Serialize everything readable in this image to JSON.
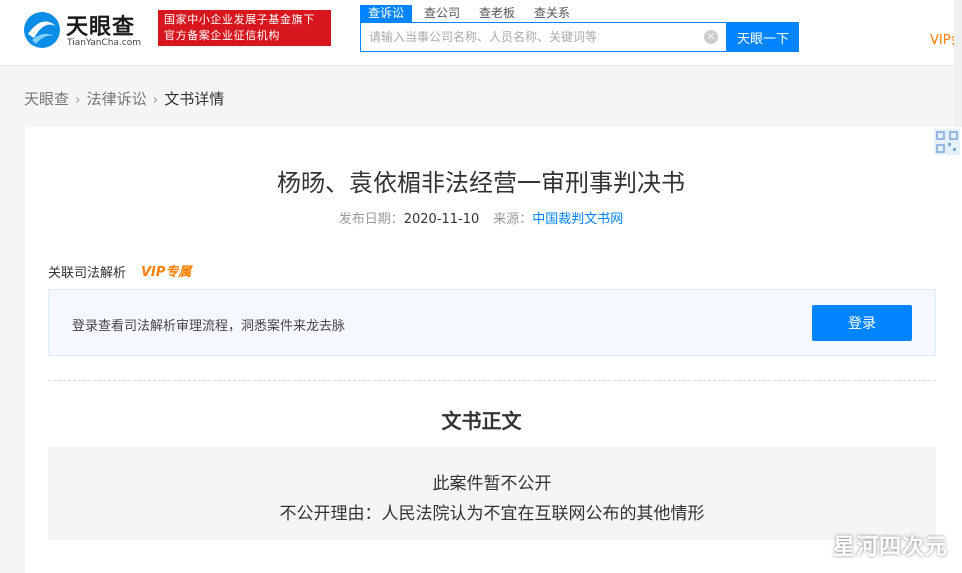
{
  "header": {
    "logo_cn": "天眼查",
    "logo_en": "TianYanCha.com",
    "badge_line1": "国家中小企业发展子基金旗下",
    "badge_line2": "官方备案企业征信机构",
    "tabs": [
      {
        "label": "查诉讼",
        "active": true
      },
      {
        "label": "查公司",
        "active": false
      },
      {
        "label": "查老板",
        "active": false
      },
      {
        "label": "查关系",
        "active": false
      }
    ],
    "search_placeholder": "请输入当事公司名称、人员名称、关键词等",
    "search_button": "天眼一下",
    "vip_link": "VIP会"
  },
  "breadcrumb": {
    "items": [
      "天眼查",
      "法律诉讼",
      "文书详情"
    ]
  },
  "document": {
    "title": "杨旸、袁依楣非法经营一审刑事判决书",
    "publish_label": "发布日期：",
    "publish_date": "2020-11-10",
    "source_label": "来源：",
    "source": "中国裁判文书网"
  },
  "related": {
    "label": "关联司法解析",
    "vip_tag": "VIP专属",
    "login_text": "登录查看司法解析审理流程，洞悉案件来龙去脉",
    "login_button": "登录"
  },
  "body": {
    "section_title": "文书正文",
    "notice_line1": "此案件暂不公开",
    "notice_line2": "不公开理由：人民法院认为不宜在互联网公布的其他情形"
  },
  "watermark": "星河四次元",
  "colors": {
    "primary": "#0084ff",
    "brand_red": "#d7161e",
    "vip_orange": "#ff7f00"
  }
}
